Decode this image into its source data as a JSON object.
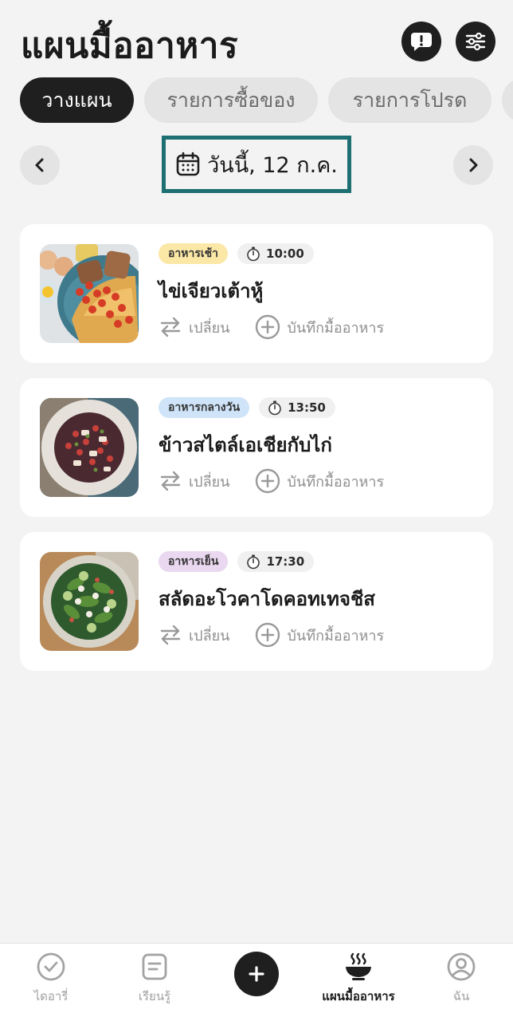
{
  "header": {
    "title": "แผนมื้ออาหาร",
    "feedback_icon": "alert-chat-icon",
    "settings_icon": "sliders-icon"
  },
  "tabs": [
    {
      "label": "วางแผน",
      "active": true
    },
    {
      "label": "รายการซื้อของ",
      "active": false
    },
    {
      "label": "รายการโปรด",
      "active": false
    }
  ],
  "date": {
    "label": "วันนี้, 12 ก.ค.",
    "icon": "calendar-icon"
  },
  "meals": [
    {
      "type": "อาหารเช้า",
      "type_color": "#fbe7a6",
      "time": "10:00",
      "name": "ไข่เจียวเต้าหู้",
      "swap_label": "เปลี่ยน",
      "log_label": "บันทึกมื้ออาหาร"
    },
    {
      "type": "อาหารกลางวัน",
      "type_color": "#cfe4f8",
      "time": "13:50",
      "name": "ข้าวสไตล์เอเชียกับไก่",
      "swap_label": "เปลี่ยน",
      "log_label": "บันทึกมื้ออาหาร"
    },
    {
      "type": "อาหารเย็น",
      "type_color": "#ead7f0",
      "time": "17:30",
      "name": "สลัดอะโวคาโดคอทเทจชีส",
      "swap_label": "เปลี่ยน",
      "log_label": "บันทึกมื้ออาหาร"
    }
  ],
  "bottom_nav": [
    {
      "label": "ไดอารี่",
      "icon": "check-circle-icon",
      "active": false
    },
    {
      "label": "เรียนรู้",
      "icon": "learn-icon",
      "active": false
    },
    {
      "label": "แผนมื้ออาหาร",
      "icon": "meal-bowl-icon",
      "active": true
    },
    {
      "label": "ฉัน",
      "icon": "profile-icon",
      "active": false
    }
  ],
  "colors": {
    "accent_dark": "#1f1f1f",
    "date_border": "#1d6f72",
    "background": "#f3f3f3"
  }
}
